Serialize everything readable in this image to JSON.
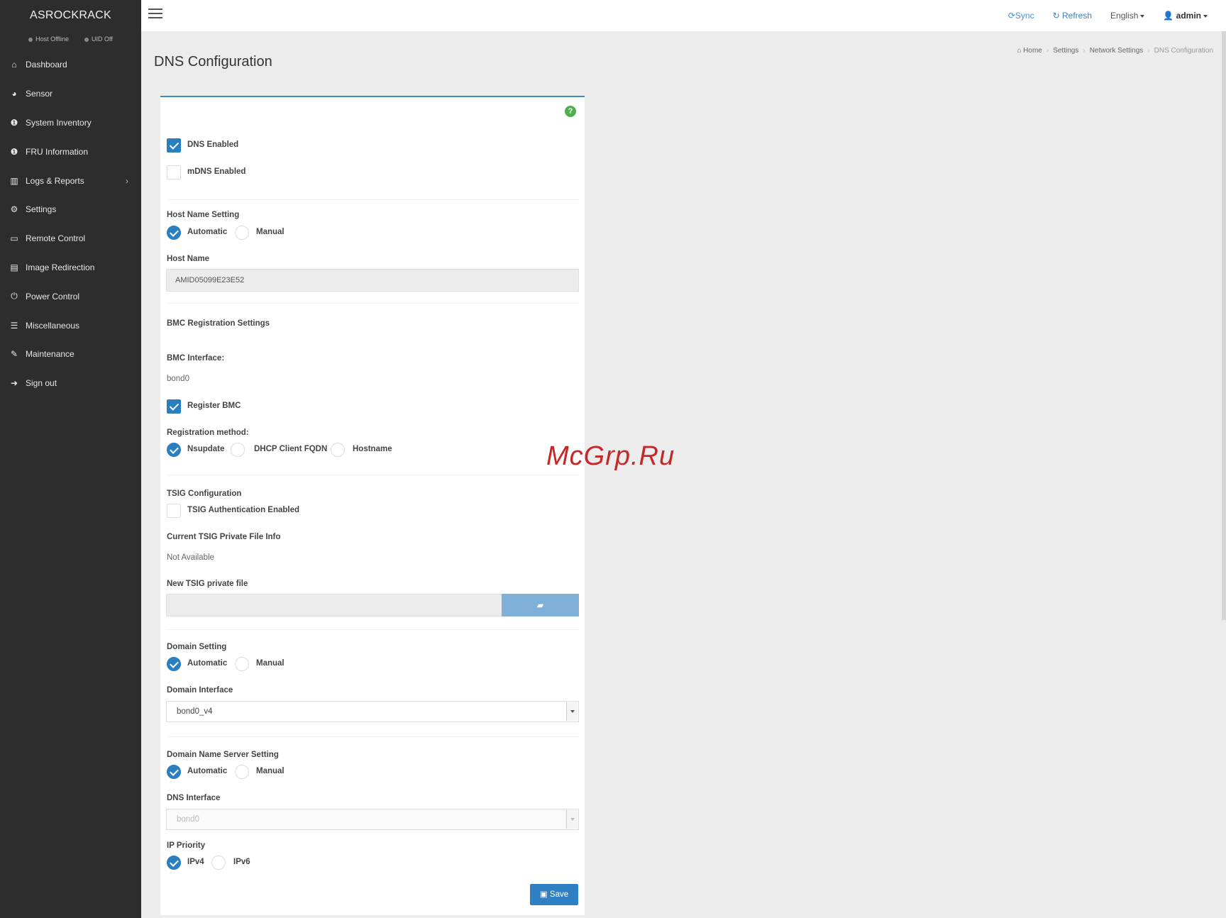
{
  "brand": "ASROCKRACK",
  "status": {
    "host": "Host Offline",
    "uid": "UID Off"
  },
  "sidebar": {
    "items": [
      {
        "label": "Dashboard",
        "icon": "home-icon"
      },
      {
        "label": "Sensor",
        "icon": "dashboard-gauge-icon"
      },
      {
        "label": "System Inventory",
        "icon": "info-circle-icon"
      },
      {
        "label": "FRU Information",
        "icon": "info-circle-icon"
      },
      {
        "label": "Logs & Reports",
        "icon": "bar-chart-icon",
        "has_submenu": true
      },
      {
        "label": "Settings",
        "icon": "gear-icon"
      },
      {
        "label": "Remote Control",
        "icon": "monitor-icon"
      },
      {
        "label": "Image Redirection",
        "icon": "disk-image-icon"
      },
      {
        "label": "Power Control",
        "icon": "power-icon"
      },
      {
        "label": "Miscellaneous",
        "icon": "list-icon"
      },
      {
        "label": "Maintenance",
        "icon": "wrench-icon"
      },
      {
        "label": "Sign out",
        "icon": "sign-out-icon"
      }
    ]
  },
  "topbar": {
    "sync": "Sync",
    "refresh": "Refresh",
    "language": "English",
    "user": "admin"
  },
  "page": {
    "title": "DNS Configuration"
  },
  "breadcrumb": [
    "Home",
    "Settings",
    "Network Settings",
    "DNS Configuration"
  ],
  "form": {
    "dns_enabled": {
      "label": "DNS Enabled",
      "checked": true
    },
    "mdns_enabled": {
      "label": "mDNS Enabled",
      "checked": false
    },
    "host_name_setting": {
      "label": "Host Name Setting",
      "options": [
        "Automatic",
        "Manual"
      ],
      "selected": "Automatic"
    },
    "host_name": {
      "label": "Host Name",
      "value": "AMID05099E23E52"
    },
    "bmc_registration": {
      "title": "BMC Registration Settings",
      "interface_label": "BMC Interface:",
      "interface_value": "bond0",
      "register_bmc": {
        "label": "Register BMC",
        "checked": true
      },
      "method_label": "Registration method:",
      "methods": [
        "Nsupdate",
        "DHCP Client FQDN",
        "Hostname"
      ],
      "method_selected": "Nsupdate"
    },
    "tsig": {
      "title": "TSIG Configuration",
      "auth": {
        "label": "TSIG Authentication Enabled",
        "checked": false
      },
      "current_label": "Current TSIG Private File Info",
      "current_value": "Not Available",
      "new_label": "New TSIG private file"
    },
    "domain_setting": {
      "label": "Domain Setting",
      "options": [
        "Automatic",
        "Manual"
      ],
      "selected": "Automatic"
    },
    "domain_interface": {
      "label": "Domain Interface",
      "value": "bond0_v4"
    },
    "dns_server_setting": {
      "label": "Domain Name Server Setting",
      "options": [
        "Automatic",
        "Manual"
      ],
      "selected": "Automatic"
    },
    "dns_interface": {
      "label": "DNS Interface",
      "value": "bond0"
    },
    "ip_priority": {
      "label": "IP Priority",
      "options": [
        "IPv4",
        "IPv6"
      ],
      "selected": "IPv4"
    },
    "save_label": "Save"
  },
  "watermark": "McGrp.Ru",
  "colors": {
    "sidebar_bg": "#2d2d2d",
    "accent": "#2a7fc1",
    "panel_top": "#3c8dbc"
  }
}
